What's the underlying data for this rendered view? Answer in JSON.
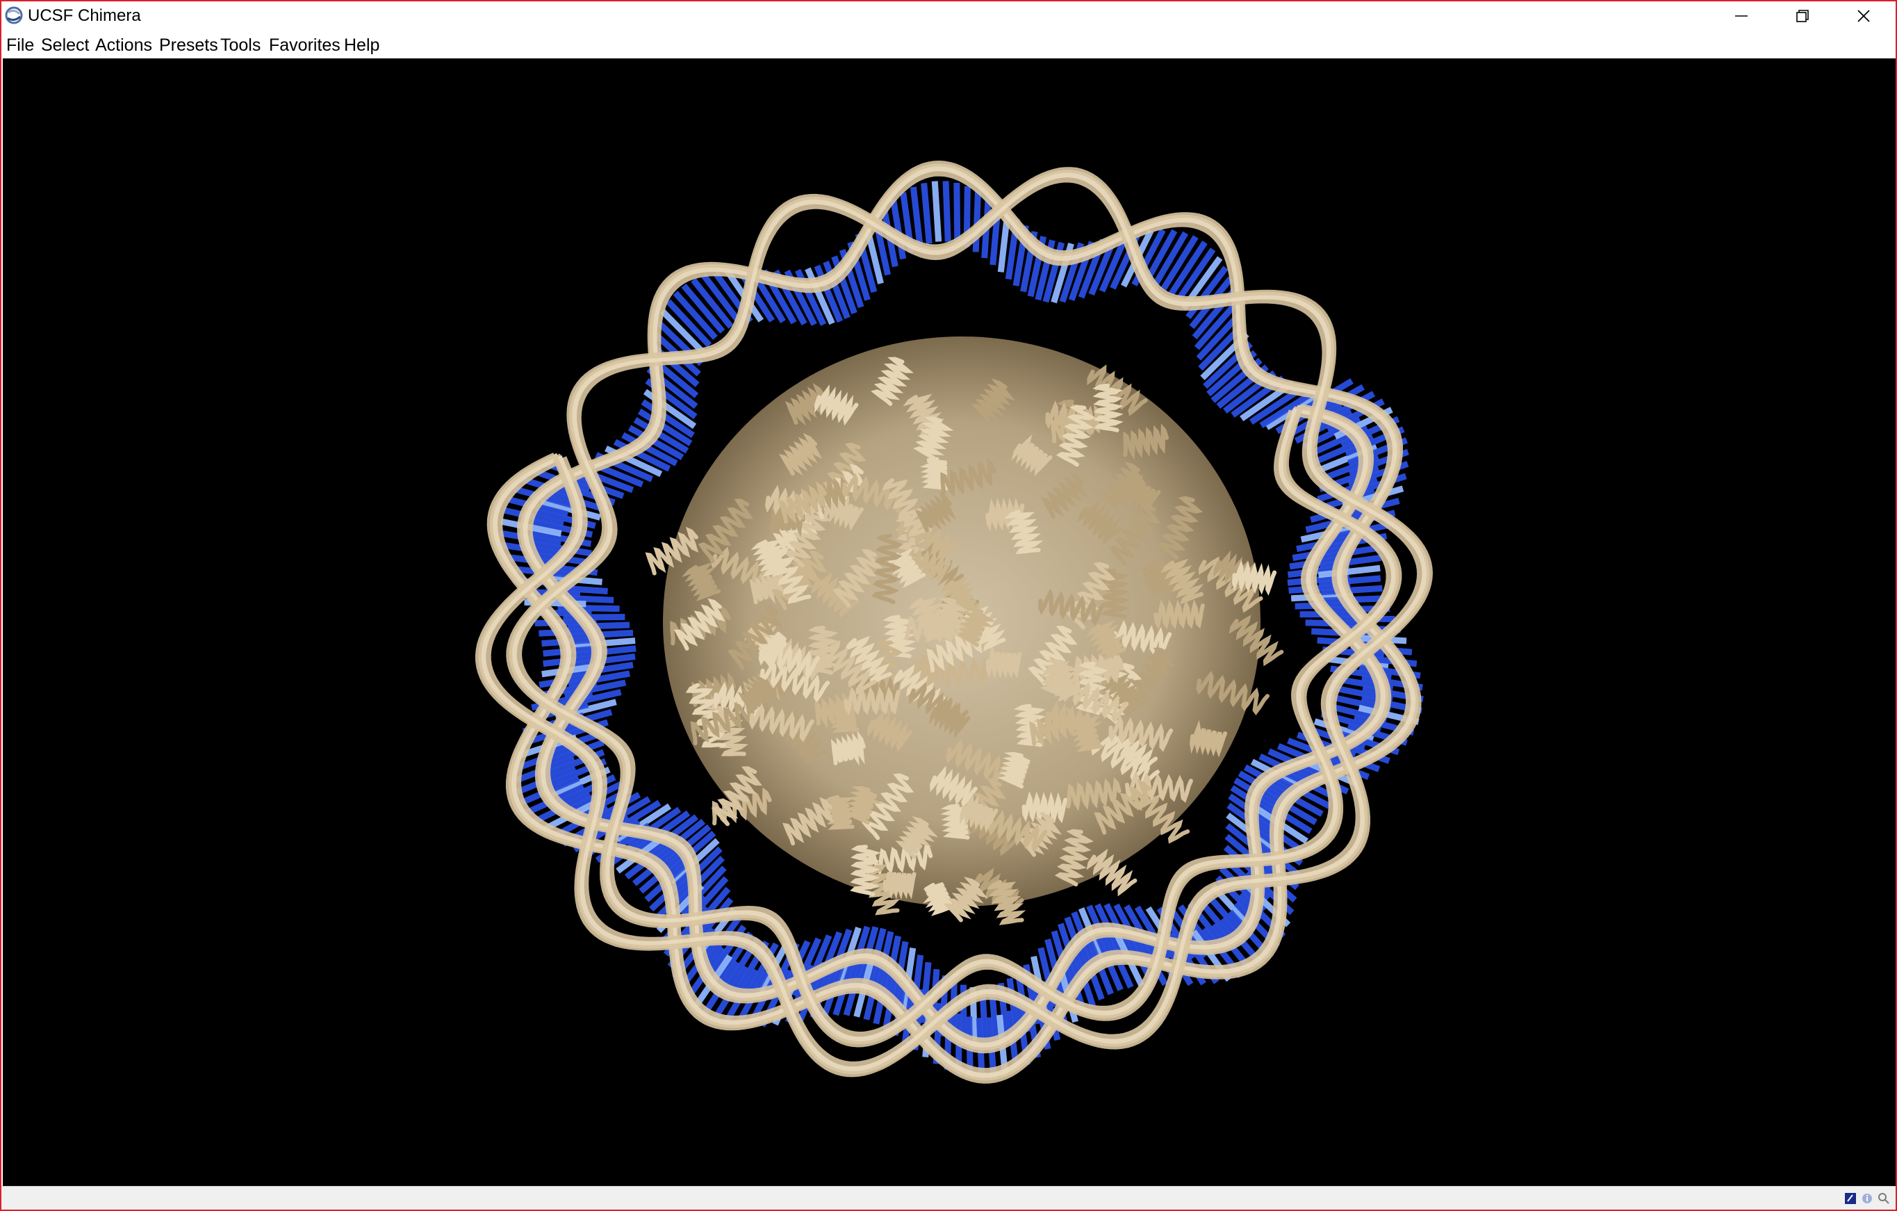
{
  "window": {
    "title": "UCSF Chimera",
    "controls": {
      "minimize": "minimize-icon",
      "restore": "restore-icon",
      "close": "close-icon"
    }
  },
  "menu": {
    "items": [
      "File",
      "Select",
      "Actions",
      "Presets",
      "Tools",
      "Favorites",
      "Help"
    ]
  },
  "viewer": {
    "background_color": "#000000",
    "ribbon_color": "#d8c4a0",
    "base_color": "#2a4fe0",
    "base_highlight_color": "#8fb6ff",
    "content": "nucleosome-molecule-render"
  },
  "status": {
    "text": "",
    "icons": [
      "command-line-icon",
      "info-icon",
      "zoom-icon"
    ]
  },
  "colors": {
    "window_border": "#d9202a"
  }
}
